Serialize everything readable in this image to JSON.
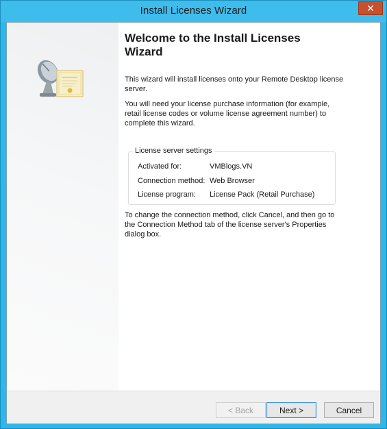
{
  "window": {
    "title": "Install Licenses Wizard",
    "close_glyph": "✕"
  },
  "icon": {
    "name": "license-server-certificate-icon"
  },
  "content": {
    "heading": "Welcome to the Install Licenses Wizard",
    "intro": "This wizard will install licenses onto your Remote Desktop license server.",
    "requirements": "You will need your license purchase information (for example, retail license codes or volume license agreement number) to complete this wizard.",
    "settings": {
      "legend": "License server settings",
      "rows": [
        {
          "label": "Activated for:",
          "value": "VMBlogs.VN"
        },
        {
          "label": "Connection method:",
          "value": "Web Browser"
        },
        {
          "label": "License program:",
          "value": "License Pack (Retail Purchase)"
        }
      ]
    },
    "change_note": "To change the connection method, click Cancel, and then go to the Connection Method tab of the license server's Properties dialog box."
  },
  "footer": {
    "back_label": "< Back",
    "next_label": "Next >",
    "cancel_label": "Cancel",
    "back_enabled": false
  },
  "colors": {
    "title_bar": "#3ebcec",
    "close_button": "#c7502f",
    "default_button_border": "#3b8fd0"
  }
}
